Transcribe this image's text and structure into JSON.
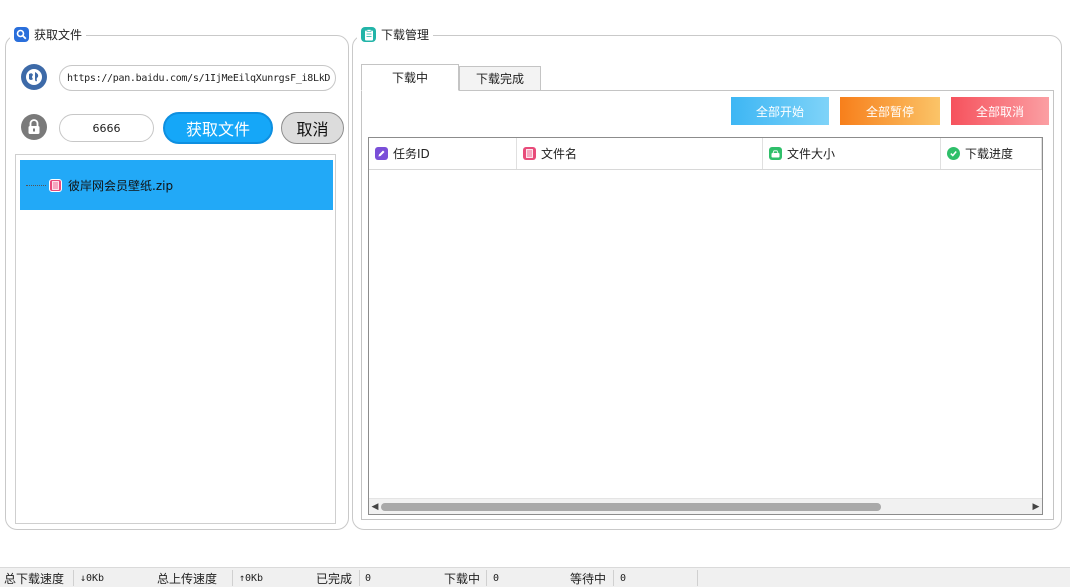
{
  "left_group": {
    "title": "获取文件",
    "url_value": "https://pan.baidu.com/s/1IjMeEilqXunrgsF_i8LkD",
    "code_value": "6666",
    "fetch_button": "获取文件",
    "cancel_button": "取消",
    "tree_items": [
      {
        "label": "彼岸网会员壁纸.zip"
      }
    ]
  },
  "right_group": {
    "title": "下载管理",
    "tabs": [
      {
        "label": "下载中"
      },
      {
        "label": "下载完成"
      }
    ],
    "actions": {
      "start_all": "全部开始",
      "pause_all": "全部暂停",
      "cancel_all": "全部取消"
    },
    "columns": [
      {
        "label": "任务ID",
        "icon": "edit-icon"
      },
      {
        "label": "文件名",
        "icon": "file-icon"
      },
      {
        "label": "文件大小",
        "icon": "drive-icon"
      },
      {
        "label": "下载进度",
        "icon": "check-icon"
      }
    ]
  },
  "statusbar": {
    "download_speed_label": "总下载速度",
    "download_speed_value": "↓0Kb",
    "upload_speed_label": "总上传速度",
    "upload_speed_value": "↑0Kb",
    "completed_label": "已完成",
    "completed_value": "0",
    "downloading_label": "下载中",
    "downloading_value": "0",
    "waiting_label": "等待中",
    "waiting_value": "0"
  },
  "colors": {
    "accent_blue": "#15a7f8",
    "start_gradient": [
      "#3db6f4",
      "#7fd3f8"
    ],
    "pause_gradient": [
      "#f77f1b",
      "#fbc468"
    ],
    "cancel_gradient": [
      "#f6525d",
      "#fb9fa3"
    ]
  }
}
